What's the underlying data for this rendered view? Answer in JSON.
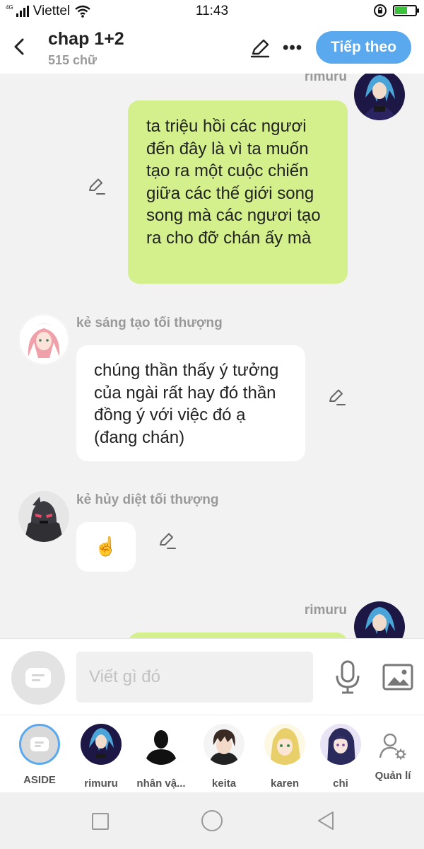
{
  "status": {
    "carrier": "Viettel",
    "network": "4G",
    "time": "11:43",
    "battery_level": 0.6
  },
  "header": {
    "title": "chap 1+2",
    "subtitle": "515 chữ",
    "next_label": "Tiếp theo"
  },
  "messages": [
    {
      "author": "rimuru",
      "text": "ta triệu hồi các ngươi đến đây là vì ta muốn tạo ra một cuộc chiến giữa các thế giới song song mà các ngươi tạo ra cho đỡ chán ấy mà"
    },
    {
      "author": "kẻ sáng tạo tối thượng",
      "text": "chúng thần thấy ý tưởng của ngài rất hay đó thần đồng ý với việc đó ạ (đang chán)"
    },
    {
      "author": "kẻ hủy diệt tối thượng",
      "text": "☝️"
    },
    {
      "author": "rimuru",
      "text": ""
    }
  ],
  "input": {
    "placeholder": "Viết gì đó"
  },
  "characters": [
    {
      "name": "ASIDE"
    },
    {
      "name": "rimuru"
    },
    {
      "name": "nhân vậ..."
    },
    {
      "name": "keita"
    },
    {
      "name": "karen"
    },
    {
      "name": "chi"
    }
  ],
  "manage_label": "Quản lí",
  "colors": {
    "accent": "#5aa9ee",
    "own_bubble": "#d3f08c",
    "background": "#f2f2f2"
  }
}
